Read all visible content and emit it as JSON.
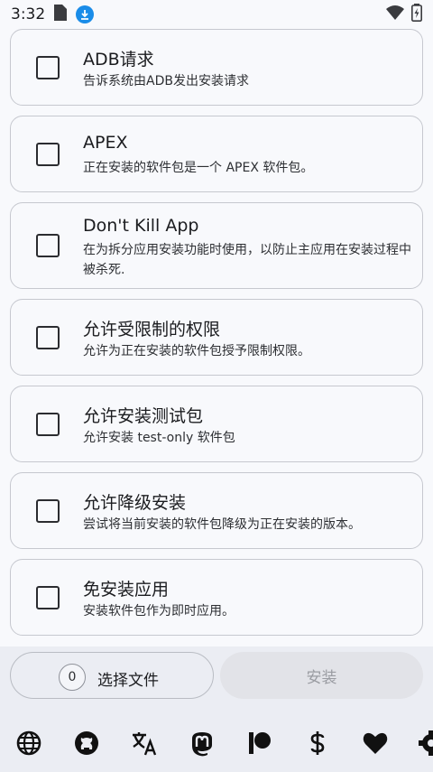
{
  "status_bar": {
    "time": "3:32"
  },
  "options": [
    {
      "title": "ADB请求",
      "desc": "告诉系统由ADB发出安装请求",
      "checked": false
    },
    {
      "title": "APEX",
      "desc": "正在安装的软件包是一个 APEX 软件包。",
      "checked": false
    },
    {
      "title": "Don't Kill App",
      "desc": "在为拆分应用安装功能时使用，以防止主应用在安装过程中被杀死.",
      "checked": false
    },
    {
      "title": "允许受限制的权限",
      "desc": "允许为正在安装的软件包授予限制权限。",
      "checked": false
    },
    {
      "title": "允许安装测试包",
      "desc": "允许安装 test-only 软件包",
      "checked": false
    },
    {
      "title": "允许降级安装",
      "desc": "尝试将当前安装的软件包降级为正在安装的版本。",
      "checked": false
    },
    {
      "title": "免安装应用",
      "desc": "安装软件包作为即时应用。",
      "checked": false
    }
  ],
  "actions": {
    "file_count": "0",
    "select_files_label": "选择文件",
    "install_label": "安装"
  },
  "nav_icons": [
    "globe-icon",
    "github-icon",
    "translate-icon",
    "mastodon-icon",
    "patreon-icon",
    "dollar-icon",
    "heart-icon",
    "settings-icon"
  ],
  "colors": {
    "download_badge": "#1a8ce8",
    "background": "#f8f9fc",
    "bottom_panel": "#ebedf3"
  }
}
